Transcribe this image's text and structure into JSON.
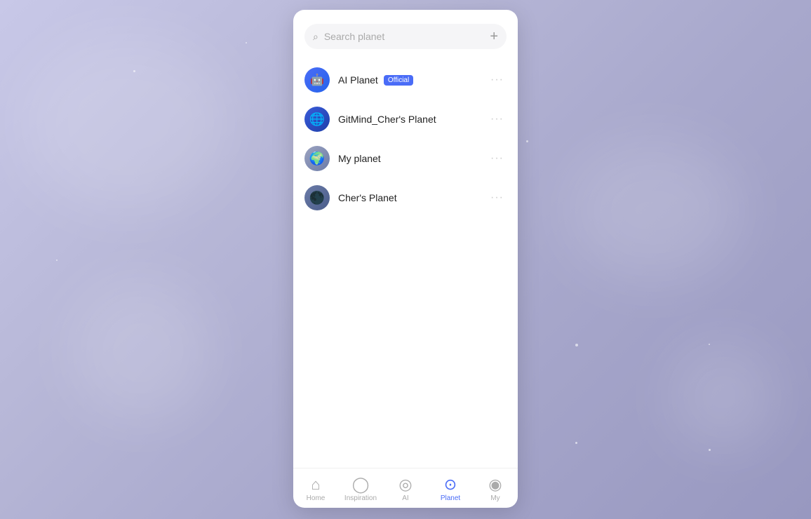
{
  "background": {
    "color_start": "#c8c8e8",
    "color_end": "#9898c0"
  },
  "panel": {
    "close_button_label": "×",
    "collapse_arrow_label": "▶"
  },
  "search": {
    "placeholder": "Search planet",
    "add_button_label": "+"
  },
  "planets": [
    {
      "id": "ai-planet",
      "name": "AI Planet",
      "badge": "Official",
      "avatar_type": "ai-planet",
      "avatar_emoji": "🤖",
      "more_label": "···"
    },
    {
      "id": "gitmind-planet",
      "name": "GitMind_Cher's Planet",
      "badge": null,
      "avatar_type": "gitmind-planet",
      "avatar_emoji": "🌐",
      "more_label": "···"
    },
    {
      "id": "my-planet",
      "name": "My planet",
      "badge": null,
      "avatar_type": "my-planet",
      "avatar_emoji": "🌍",
      "more_label": "···"
    },
    {
      "id": "cher-planet",
      "name": "Cher's Planet",
      "badge": null,
      "avatar_type": "cher-planet",
      "avatar_emoji": "🌑",
      "more_label": "···"
    }
  ],
  "nav": {
    "items": [
      {
        "id": "home",
        "label": "Home",
        "icon": "⌂",
        "active": false
      },
      {
        "id": "inspiration",
        "label": "Inspiration",
        "icon": "◯",
        "active": false
      },
      {
        "id": "ai",
        "label": "AI",
        "icon": "◎",
        "active": false
      },
      {
        "id": "planet",
        "label": "Planet",
        "icon": "⊙",
        "active": true
      },
      {
        "id": "my",
        "label": "My",
        "icon": "◉",
        "active": false
      }
    ]
  }
}
